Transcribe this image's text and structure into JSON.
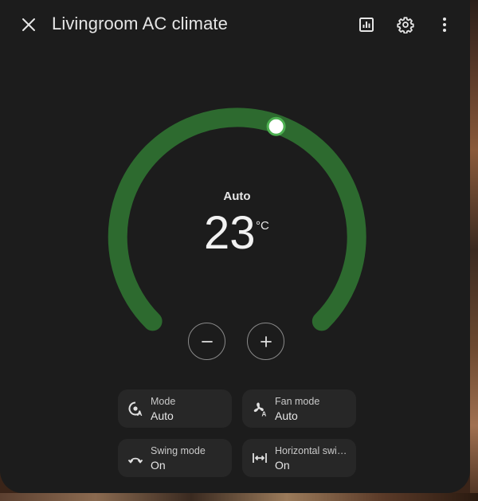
{
  "header": {
    "title": "Livingroom AC climate",
    "icons": [
      "close-icon",
      "history-chart-icon",
      "gear-icon",
      "more-vert-icon"
    ]
  },
  "thermostat": {
    "mode": "Auto",
    "target_temperature": "23",
    "unit": "°C",
    "arc_color": "#2d6a2f",
    "thumb_color": "#4caf50"
  },
  "controls": {
    "decrease_icon": "minus-icon",
    "increase_icon": "plus-icon"
  },
  "tiles": [
    {
      "name": "Mode",
      "value": "Auto",
      "icon": "thermostat-auto-icon"
    },
    {
      "name": "Fan mode",
      "value": "Auto",
      "icon": "fan-auto-icon"
    },
    {
      "name": "Swing mode",
      "value": "On",
      "icon": "arrow-oscillating-icon"
    },
    {
      "name": "Horizontal swing mode",
      "value": "On",
      "icon": "arrow-expand-horizontal-icon"
    }
  ]
}
